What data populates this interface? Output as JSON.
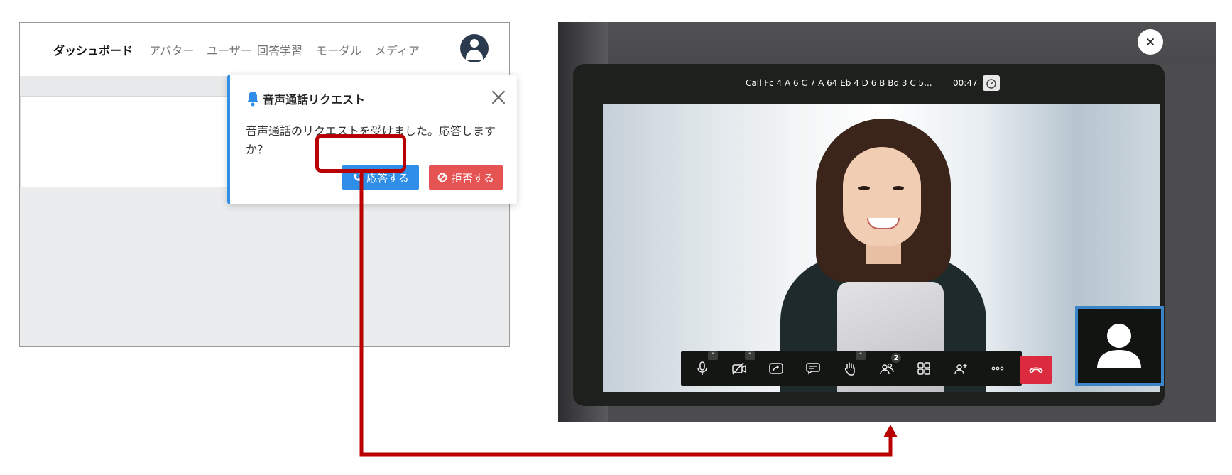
{
  "left": {
    "nav": [
      "ダッシュボード",
      "アバター",
      "ユーザー",
      "回答学習",
      "モーダル",
      "メディア"
    ],
    "notification": {
      "title": "音声通話リクエスト",
      "message": "音声通話のリクエストを受けました。応答しますか？",
      "answer_label": "応答する",
      "reject_label": "拒否する"
    }
  },
  "call": {
    "title": "Call Fc 4 A 6 C 7 A 64 Eb 4 D 6 B Bd 3 C 5...",
    "timer": "00:47",
    "participants_count": "2",
    "toolbar_icons": [
      "microphone-icon",
      "camera-off-icon",
      "share-screen-icon",
      "chat-icon",
      "raise-hand-icon",
      "participants-icon",
      "tile-view-icon",
      "invite-icon",
      "more-icon",
      "hangup-icon"
    ]
  },
  "colors": {
    "primary": "#2e8ee8",
    "danger": "#e55353",
    "highlight": "#b80000",
    "hangup": "#dc2b3e",
    "self_view_border": "#3a84c7"
  }
}
